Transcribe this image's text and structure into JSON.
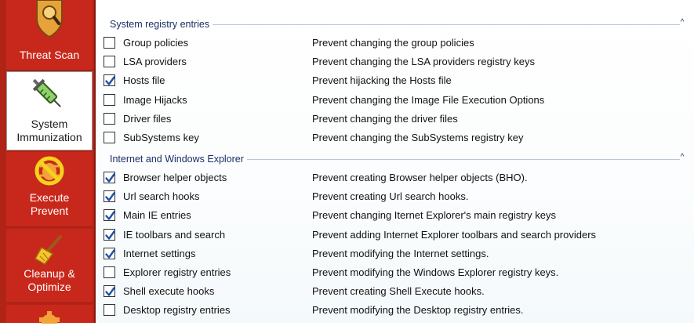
{
  "sidebar": {
    "items": [
      {
        "label_lines": [
          "Threat Scan"
        ],
        "icon": "shield-icon",
        "active": false
      },
      {
        "label_lines": [
          "System",
          "Immunization"
        ],
        "icon": "syringe-icon",
        "active": true
      },
      {
        "label_lines": [
          "Execute",
          "Prevent"
        ],
        "icon": "prohibited-bug-icon",
        "active": false
      },
      {
        "label_lines": [
          "Cleanup &",
          "Optimize"
        ],
        "icon": "broom-icon",
        "active": false
      },
      {
        "label_lines": [],
        "icon": "gear-icon",
        "active": false
      }
    ]
  },
  "sections": [
    {
      "title": "System registry entries",
      "collapse_glyph": "^",
      "rows": [
        {
          "label": "Group policies",
          "desc": "Prevent changing the group policies",
          "checked": false
        },
        {
          "label": "LSA providers",
          "desc": "Prevent changing the LSA providers registry keys",
          "checked": false
        },
        {
          "label": "Hosts file",
          "desc": "Prevent hijacking the Hosts file",
          "checked": true
        },
        {
          "label": "Image Hijacks",
          "desc": "Prevent changing the Image  File Execution Options",
          "checked": false
        },
        {
          "label": "Driver files",
          "desc": "Prevent changing the driver files",
          "checked": false
        },
        {
          "label": "SubSystems key",
          "desc": "Prevent changing the SubSystems registry key",
          "checked": false
        }
      ]
    },
    {
      "title": "Internet and Windows Explorer",
      "collapse_glyph": "^",
      "rows": [
        {
          "label": "Browser helper objects",
          "desc": "Prevent creating Browser helper objects (BHO).",
          "checked": true
        },
        {
          "label": "Url search hooks",
          "desc": "Prevent creating Url search hooks.",
          "checked": true
        },
        {
          "label": "Main IE entries",
          "desc": "Prevent changing Iternet Explorer's main registry keys",
          "checked": true
        },
        {
          "label": "IE toolbars and search",
          "desc": "Prevent adding Internet Explorer toolbars and search providers",
          "checked": true
        },
        {
          "label": "Internet settings",
          "desc": "Prevent modifying the Internet settings.",
          "checked": true
        },
        {
          "label": "Explorer registry entries",
          "desc": "Prevent modifying the Windows Explorer registry keys.",
          "checked": false
        },
        {
          "label": "Shell execute hooks",
          "desc": "Prevent creating Shell Execute hooks.",
          "checked": true
        },
        {
          "label": "Desktop registry entries",
          "desc": "Prevent modifying the Desktop registry entries.",
          "checked": false
        }
      ]
    }
  ],
  "colors": {
    "sidebar_bg": "#c8281b",
    "section_title": "#1b2f66",
    "checkmark": "#1f4fa8"
  }
}
